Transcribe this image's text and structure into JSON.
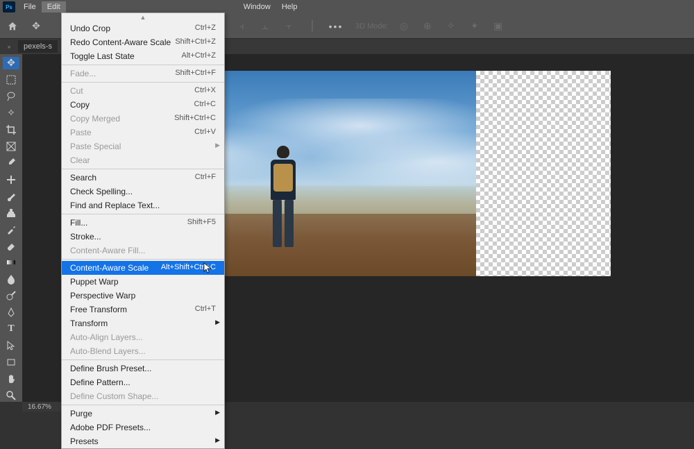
{
  "menubar": {
    "app_icon": "Ps",
    "items": [
      "File",
      "Edit"
    ],
    "items_right": [
      "Window",
      "Help"
    ]
  },
  "optionbar": {
    "mode_label": "3D Mode:"
  },
  "tabbar": {
    "tab_label": "pexels-s"
  },
  "statusbar": {
    "zoom": "16.67%"
  },
  "edit_menu": [
    {
      "label": "Undo Crop",
      "shortcut": "Ctrl+Z",
      "type": "item"
    },
    {
      "label": "Redo Content-Aware Scale",
      "shortcut": "Shift+Ctrl+Z",
      "type": "item"
    },
    {
      "label": "Toggle Last State",
      "shortcut": "Alt+Ctrl+Z",
      "type": "item"
    },
    {
      "type": "sep"
    },
    {
      "label": "Fade...",
      "shortcut": "Shift+Ctrl+F",
      "type": "item",
      "disabled": true
    },
    {
      "type": "sep"
    },
    {
      "label": "Cut",
      "shortcut": "Ctrl+X",
      "type": "item",
      "disabled": true
    },
    {
      "label": "Copy",
      "shortcut": "Ctrl+C",
      "type": "item"
    },
    {
      "label": "Copy Merged",
      "shortcut": "Shift+Ctrl+C",
      "type": "item",
      "disabled": true
    },
    {
      "label": "Paste",
      "shortcut": "Ctrl+V",
      "type": "item",
      "disabled": true
    },
    {
      "label": "Paste Special",
      "type": "submenu",
      "disabled": true
    },
    {
      "label": "Clear",
      "type": "item",
      "disabled": true
    },
    {
      "type": "sep"
    },
    {
      "label": "Search",
      "shortcut": "Ctrl+F",
      "type": "item"
    },
    {
      "label": "Check Spelling...",
      "type": "item"
    },
    {
      "label": "Find and Replace Text...",
      "type": "item"
    },
    {
      "type": "sep"
    },
    {
      "label": "Fill...",
      "shortcut": "Shift+F5",
      "type": "item"
    },
    {
      "label": "Stroke...",
      "type": "item"
    },
    {
      "label": "Content-Aware Fill...",
      "type": "item",
      "disabled": true
    },
    {
      "type": "sep"
    },
    {
      "label": "Content-Aware Scale",
      "shortcut": "Alt+Shift+Ctrl+C",
      "type": "item",
      "highlighted": true
    },
    {
      "label": "Puppet Warp",
      "type": "item"
    },
    {
      "label": "Perspective Warp",
      "type": "item"
    },
    {
      "label": "Free Transform",
      "shortcut": "Ctrl+T",
      "type": "item"
    },
    {
      "label": "Transform",
      "type": "submenu"
    },
    {
      "label": "Auto-Align Layers...",
      "type": "item",
      "disabled": true
    },
    {
      "label": "Auto-Blend Layers...",
      "type": "item",
      "disabled": true
    },
    {
      "type": "sep"
    },
    {
      "label": "Define Brush Preset...",
      "type": "item"
    },
    {
      "label": "Define Pattern...",
      "type": "item"
    },
    {
      "label": "Define Custom Shape...",
      "type": "item",
      "disabled": true
    },
    {
      "type": "sep"
    },
    {
      "label": "Purge",
      "type": "submenu"
    },
    {
      "label": "Adobe PDF Presets...",
      "type": "item"
    },
    {
      "label": "Presets",
      "type": "submenu"
    }
  ],
  "tools": [
    "move",
    "marquee",
    "lasso",
    "magic-wand",
    "crop",
    "frame",
    "eyedropper",
    "healing",
    "brush",
    "clone",
    "history-brush",
    "eraser",
    "gradient",
    "blur",
    "dodge",
    "pen",
    "type",
    "path-select",
    "rectangle",
    "hand",
    "zoom"
  ]
}
